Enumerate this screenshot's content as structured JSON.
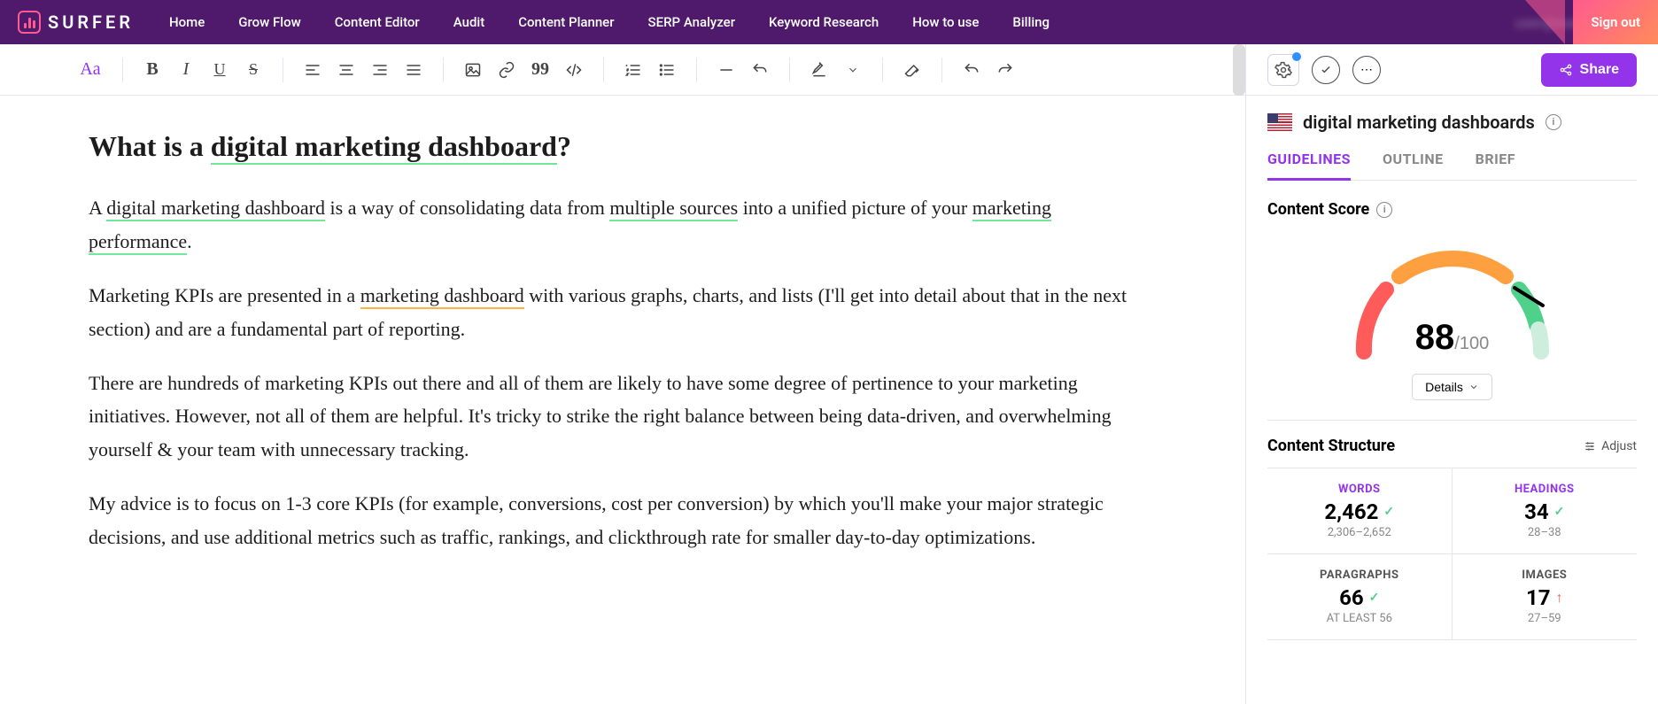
{
  "nav": {
    "brand": "SURFER",
    "links": [
      "Home",
      "Grow Flow",
      "Content Editor",
      "Audit",
      "Content Planner",
      "SERP Analyzer",
      "Keyword Research",
      "How to use",
      "Billing"
    ],
    "email": "user@example.com",
    "signout": "Sign out"
  },
  "toolbar": {
    "text_style": "Aa"
  },
  "content": {
    "h2_pre": "What is a ",
    "h2_hl": "digital marketing dashboard",
    "h2_post": "?",
    "p1_a": "A ",
    "p1_hl1": "digital marketing dashboard",
    "p1_b": " is a way of consolidating data from ",
    "p1_hl2": "multiple sources",
    "p1_c": " into a unified picture of your ",
    "p1_hl3": "marketing performance",
    "p1_d": ".",
    "p2_a": "Marketing KPIs are presented in a ",
    "p2_hl1": "marketing dashboard",
    "p2_b": " with various graphs, charts, and lists (I'll get into detail about that in the next section) and are a fundamental part of reporting.",
    "p3": "There are hundreds of marketing KPIs out there and all of them are likely to have some degree of pertinence to your marketing initiatives. However, not all of them are helpful. It's tricky to strike the right balance between being data-driven, and overwhelming yourself & your team with unnecessary tracking.",
    "p4": "My advice is to focus on 1-3 core KPIs (for example, conversions, cost per conversion) by which you'll make your major strategic decisions, and use additional metrics such as traffic, rankings, and clickthrough rate for smaller day-to-day optimizations."
  },
  "side": {
    "share": "Share",
    "keyword": "digital marketing dashboards",
    "tabs": [
      "GUIDELINES",
      "OUTLINE",
      "BRIEF"
    ],
    "score_label": "Content Score",
    "score": "88",
    "score_max": "/100",
    "details": "Details",
    "struct_label": "Content Structure",
    "adjust": "Adjust",
    "metrics": {
      "words": {
        "label": "WORDS",
        "value": "2,462",
        "range": "2,306–2,652",
        "status": "ok"
      },
      "headings": {
        "label": "HEADINGS",
        "value": "34",
        "range": "28–38",
        "status": "ok"
      },
      "paragraphs": {
        "label": "PARAGRAPHS",
        "value": "66",
        "range": "AT LEAST 56",
        "status": "ok"
      },
      "images": {
        "label": "IMAGES",
        "value": "17",
        "range": "27–59",
        "status": "warn"
      }
    }
  }
}
